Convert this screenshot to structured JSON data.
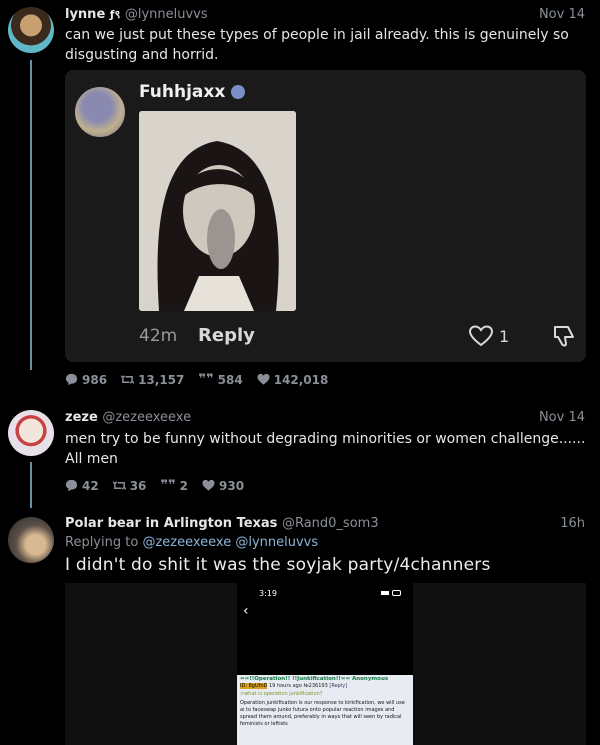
{
  "post1": {
    "name": "lynne",
    "name_glyph": "ƒ९",
    "handle": "@lynneluvvs",
    "time": "Nov 14",
    "text": "can we just put these types of people in jail already. this is genuinely so disgusting and horrid.",
    "stats": {
      "replies": "986",
      "retweets": "13,157",
      "quotes": "584",
      "likes": "142,018"
    }
  },
  "embed": {
    "name": "Fuhhjaxx",
    "time": "42m",
    "reply_label": "Reply",
    "like_count": "1"
  },
  "post2": {
    "name": "zeze",
    "handle": "@zezeexeexe",
    "time": "Nov 14",
    "text": "men try to be funny without degrading minorities or women challenge...... All men",
    "stats": {
      "replies": "42",
      "retweets": "36",
      "quotes": "2",
      "likes": "930"
    }
  },
  "post3": {
    "name": "Polar bear in Arlington Texas",
    "handle": "@Rand0_som3",
    "time": "16h",
    "replying_prefix": "Replying to",
    "replying_to": "@zezeexeexe @lynneluvvs",
    "text": "I didn't do shit it was the soyjak party/4channers"
  },
  "phone": {
    "time": "3:19",
    "back": "‹",
    "post_title": "==!!Operation!! !!Junkification!!== Anonymous",
    "post_meta": "19 hours ago №236193",
    "post_id": "ID: 8gUfnD",
    "reply_link": "[Reply]",
    "question": ">what is operation junkification?",
    "body": "Operation junkification is our response to kirkification, we will use ai to faceswap junko futura onto popular reaction images and spread them around, preferably in ways that will seen by radical feminists or leftists"
  }
}
